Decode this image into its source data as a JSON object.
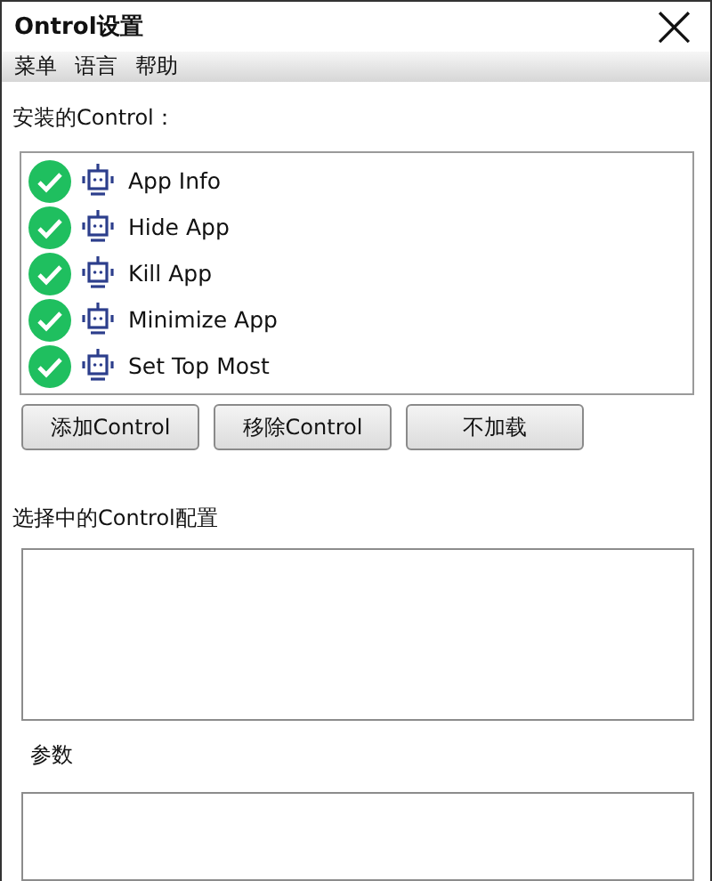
{
  "window": {
    "title": "Ontrol设置",
    "close": "×"
  },
  "menu": [
    "菜单",
    "语言",
    "帮助"
  ],
  "installed_label": "安装的Control：",
  "controls": [
    {
      "name": "App Info",
      "checked": true
    },
    {
      "name": "Hide App",
      "checked": true
    },
    {
      "name": "Kill App",
      "checked": true
    },
    {
      "name": "Minimize App",
      "checked": true
    },
    {
      "name": "Set Top Most",
      "checked": true
    }
  ],
  "buttons": [
    "添加Control",
    "移除Control",
    "不加载"
  ],
  "config_label": "选择中的Control配置",
  "params_label": "参数"
}
